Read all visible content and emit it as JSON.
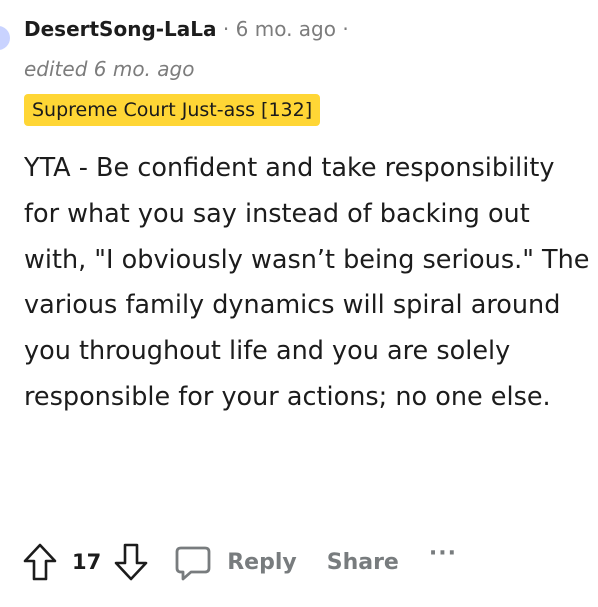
{
  "comment": {
    "author": "DesertSong-LaLa",
    "separator": "·",
    "timestamp": "6 mo. ago",
    "edited": "edited 6 mo. ago",
    "flair": "Supreme Court Just-ass [132]",
    "body": "YTA - Be confident and take responsibility for what you say instead of backing out with, \"I obviously wasn’t being serious.\" The various family dynamics will spiral around you throughout life and you are solely responsible for your actions; no one else."
  },
  "actions": {
    "score": "17",
    "reply_label": "Reply",
    "share_label": "Share",
    "more_label": "···"
  },
  "colors": {
    "flair_bg": "#ffd635",
    "meta": "#7c7c7c",
    "action": "#787c7e"
  },
  "icons": [
    "upvote-arrow-icon",
    "downvote-arrow-icon",
    "comment-bubble-icon",
    "more-dots-icon"
  ]
}
